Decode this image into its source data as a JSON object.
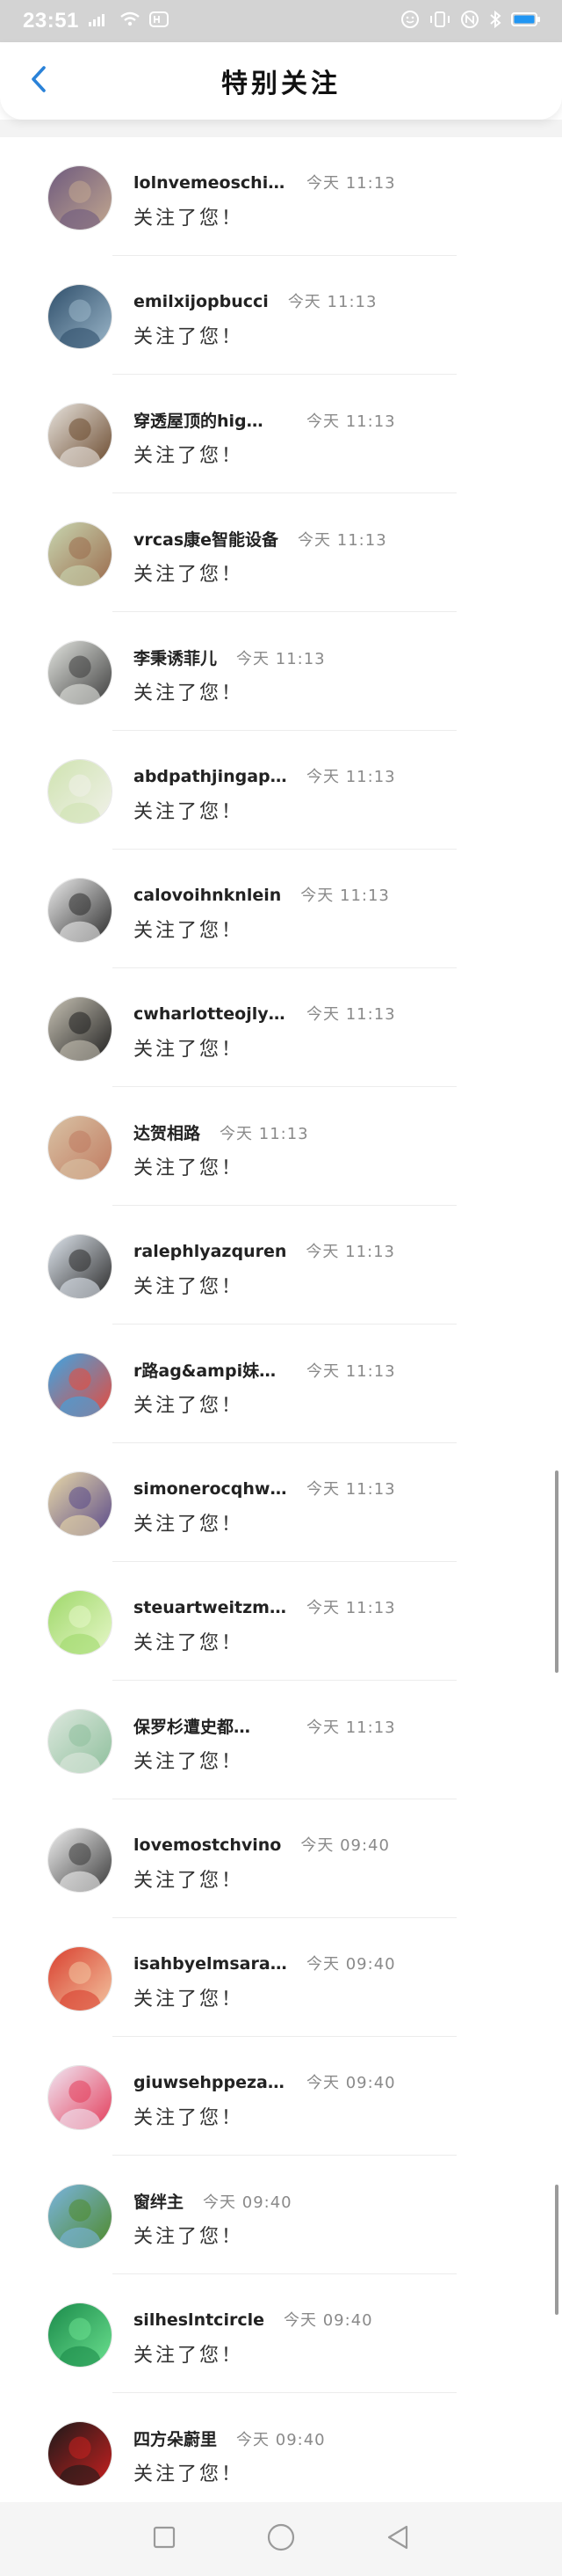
{
  "status_bar": {
    "time": "23:51",
    "signal_text": "⸴⸴ıl",
    "icons": [
      "hd-icon",
      "wifi-icon",
      "battery-saver-icon",
      "nfc-icon",
      "bluetooth-icon",
      "battery-icon"
    ],
    "battery_color": "#2196f3"
  },
  "header": {
    "title": "特别关注",
    "back_icon": "chevron-left-icon",
    "accent_color": "#2a82d8"
  },
  "list": {
    "items": [
      {
        "name": "lolnvemeoschino",
        "time": "今天 11:13",
        "message": "关注了您！",
        "avatar_colors": [
          "#6e5a7e",
          "#c2a78f"
        ]
      },
      {
        "name": "emilxijopbucci",
        "time": "今天 11:13",
        "message": "关注了您！",
        "avatar_colors": [
          "#2f4f6b",
          "#9bb6c9"
        ]
      },
      {
        "name": "穿透屋顶的hig…",
        "time": "今天 11:13",
        "message": "关注了您！",
        "avatar_colors": [
          "#e7e3dd",
          "#6b4a2e"
        ]
      },
      {
        "name": "vrcas康e智能设备",
        "time": "今天 11:13",
        "message": "关注了您！",
        "avatar_colors": [
          "#c8d6b0",
          "#9b6b4d"
        ]
      },
      {
        "name": "李秉诱菲儿",
        "time": "今天 11:13",
        "message": "关注了您！",
        "avatar_colors": [
          "#e2e4df",
          "#3d3d3d"
        ]
      },
      {
        "name": "abdpathjingapcez",
        "time": "今天 11:13",
        "message": "关注了您！",
        "avatar_colors": [
          "#cfe3b0",
          "#f1f1ea"
        ]
      },
      {
        "name": "calovoihnknlein",
        "time": "今天 11:13",
        "message": "关注了您！",
        "avatar_colors": [
          "#ececec",
          "#2b2b2b"
        ]
      },
      {
        "name": "cwharlotteojlym…",
        "time": "今天 11:13",
        "message": "关注了您！",
        "avatar_colors": [
          "#c7c2b4",
          "#1f1f1f"
        ]
      },
      {
        "name": "达贺相路",
        "time": "今天 11:13",
        "message": "关注了您！",
        "avatar_colors": [
          "#d9c3a5",
          "#c07a60"
        ]
      },
      {
        "name": "ralephlyazquren",
        "time": "今天 11:13",
        "message": "关注了您！",
        "avatar_colors": [
          "#dfe6ee",
          "#2a2a2a"
        ]
      },
      {
        "name": "r路ag&ampi妹…",
        "time": "今天 11:13",
        "message": "关注了您！",
        "avatar_colors": [
          "#3aa6e6",
          "#e94a3b"
        ]
      },
      {
        "name": "simonerocqhwfa",
        "time": "今天 11:13",
        "message": "关注了您！",
        "avatar_colors": [
          "#e9d9a8",
          "#5a4a8a"
        ]
      },
      {
        "name": "steuartweitzmanuk",
        "time": "今天 11:13",
        "message": "关注了您！",
        "avatar_colors": [
          "#9fd86a",
          "#e6f7c8"
        ]
      },
      {
        "name": "保罗杉遭史都…",
        "time": "今天 11:13",
        "message": "关注了您！",
        "avatar_colors": [
          "#dde8de",
          "#8ebf9c"
        ]
      },
      {
        "name": "lovemostchvino",
        "time": "今天 09:40",
        "message": "关注了您！",
        "avatar_colors": [
          "#f0f0f0",
          "#3a3a3a"
        ]
      },
      {
        "name": "isahbyelmsarajtnt",
        "time": "今天 09:40",
        "message": "关注了您！",
        "avatar_colors": [
          "#d9402f",
          "#f3c4a0"
        ]
      },
      {
        "name": "giuwsehppezanotti",
        "time": "今天 09:40",
        "message": "关注了您！",
        "avatar_colors": [
          "#f0e8f4",
          "#e33c5a"
        ]
      },
      {
        "name": "窗绊主",
        "time": "今天 09:40",
        "message": "关注了您！",
        "avatar_colors": [
          "#7ab4e0",
          "#4f8a2a"
        ]
      },
      {
        "name": "silheslntcircle",
        "time": "今天 09:40",
        "message": "关注了您！",
        "avatar_colors": [
          "#1a8a4a",
          "#6be08f"
        ]
      },
      {
        "name": "四方朵蔚里",
        "time": "今天 09:40",
        "message": "关注了您！",
        "avatar_colors": [
          "#1a1a1a",
          "#c8201f"
        ]
      }
    ]
  },
  "nav_bar": {
    "buttons": [
      "recents-square-icon",
      "home-circle-icon",
      "back-triangle-icon"
    ]
  }
}
